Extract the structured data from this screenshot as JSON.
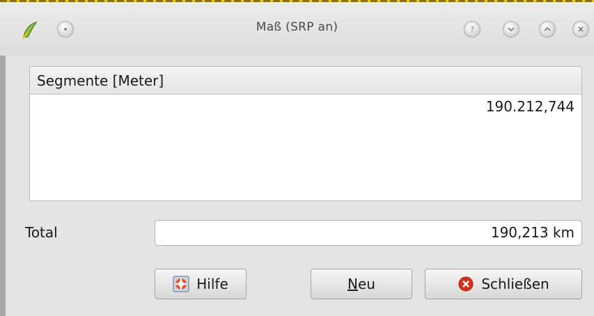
{
  "window": {
    "title": "Maß (SRP an)",
    "buttons": [
      "help-icon",
      "minimize-icon",
      "maximize-icon",
      "close-icon"
    ]
  },
  "table": {
    "header": "Segmente [Meter]",
    "rows": [
      "190.212,744"
    ]
  },
  "total": {
    "label": "Total",
    "value": "190,213 km"
  },
  "buttons": {
    "help": "Hilfe",
    "new_mnemonic": "N",
    "new_rest": "eu",
    "close": "Schließen"
  },
  "colors": {
    "window_bg": "#e4e4e2",
    "close_icon": "#d9301e",
    "help_icon": "#e0582a"
  }
}
